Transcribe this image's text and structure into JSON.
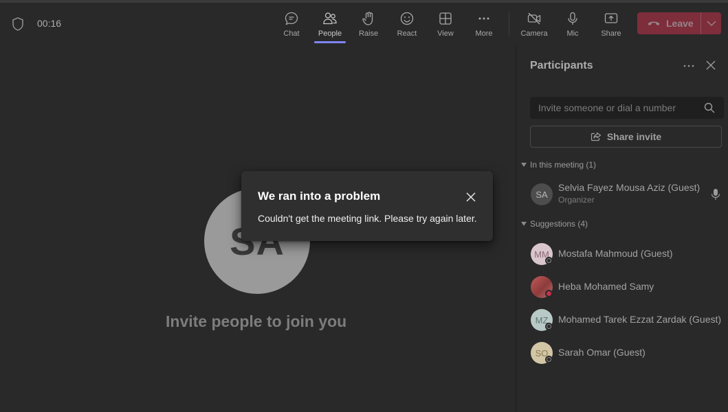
{
  "meeting": {
    "timer": "00:16"
  },
  "toolbar": {
    "buttons": [
      {
        "label": "Chat",
        "icon": "chat-icon"
      },
      {
        "label": "People",
        "icon": "people-icon",
        "active": true
      },
      {
        "label": "Raise",
        "icon": "raise-hand-icon"
      },
      {
        "label": "React",
        "icon": "react-icon"
      },
      {
        "label": "View",
        "icon": "view-grid-icon"
      },
      {
        "label": "More",
        "icon": "more-icon"
      },
      {
        "label": "Camera",
        "icon": "camera-off-icon"
      },
      {
        "label": "Mic",
        "icon": "mic-icon"
      },
      {
        "label": "Share",
        "icon": "share-tray-icon"
      }
    ],
    "leave_label": "Leave",
    "leave_color": "#c4314b"
  },
  "stage": {
    "avatar_initials": "SA",
    "invite_text": "Invite people to join you"
  },
  "error_toast": {
    "title": "We ran into a problem",
    "message": "Couldn't get the meeting link. Please try again later."
  },
  "participants_panel": {
    "title": "Participants",
    "search_placeholder": "Invite someone or dial a number",
    "share_invite_label": "Share invite",
    "in_meeting_section": "In this meeting (1)",
    "suggestions_section": "Suggestions (4)",
    "in_meeting": [
      {
        "initials": "SA",
        "name": "Selvia Fayez Mousa Aziz (Guest)",
        "role": "Organizer"
      }
    ],
    "suggestions": [
      {
        "initials": "MM",
        "name": "Mostafa Mahmoud (Guest)",
        "avatar_color": "#d9c6cc"
      },
      {
        "initials": "",
        "name": "Heba Mohamed Samy",
        "avatar_color": "#b24a4a"
      },
      {
        "initials": "MZ",
        "name": "Mohamed Tarek Ezzat Zardak (Guest)",
        "avatar_color": "#b9c9c7"
      },
      {
        "initials": "SO",
        "name": "Sarah Omar (Guest)",
        "avatar_color": "#d2c6a6"
      }
    ]
  },
  "colors": {
    "accent": "#7f85f5",
    "background": "#292929"
  }
}
